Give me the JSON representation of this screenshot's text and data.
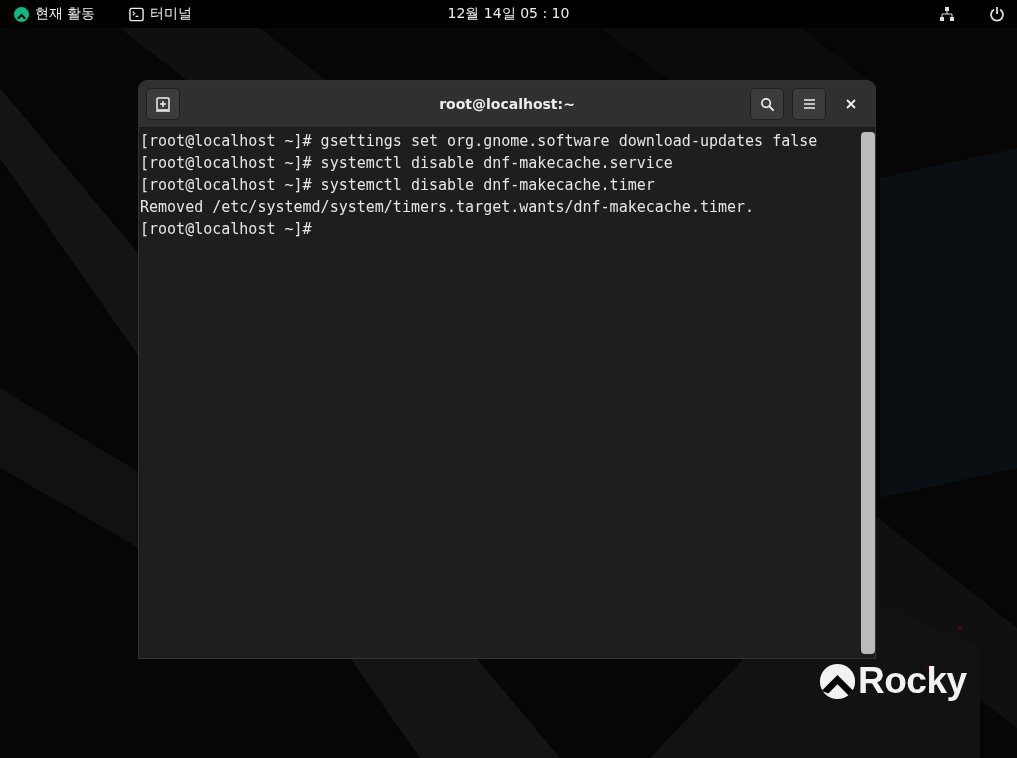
{
  "top_bar": {
    "activities": "현재 활동",
    "app": "터미널",
    "clock": "12월 14일 05 : 10"
  },
  "window": {
    "title": "root@localhost:~"
  },
  "terminal": {
    "lines": [
      "[root@localhost ~]# gsettings set org.gnome.software download-updates false",
      "[root@localhost ~]# systemctl disable dnf-makecache.service",
      "[root@localhost ~]# systemctl disable dnf-makecache.timer",
      "Removed /etc/systemd/system/timers.target.wants/dnf-makecache.timer.",
      "[root@localhost ~]#"
    ]
  },
  "wallpaper": {
    "logo_text": "Rocky"
  }
}
